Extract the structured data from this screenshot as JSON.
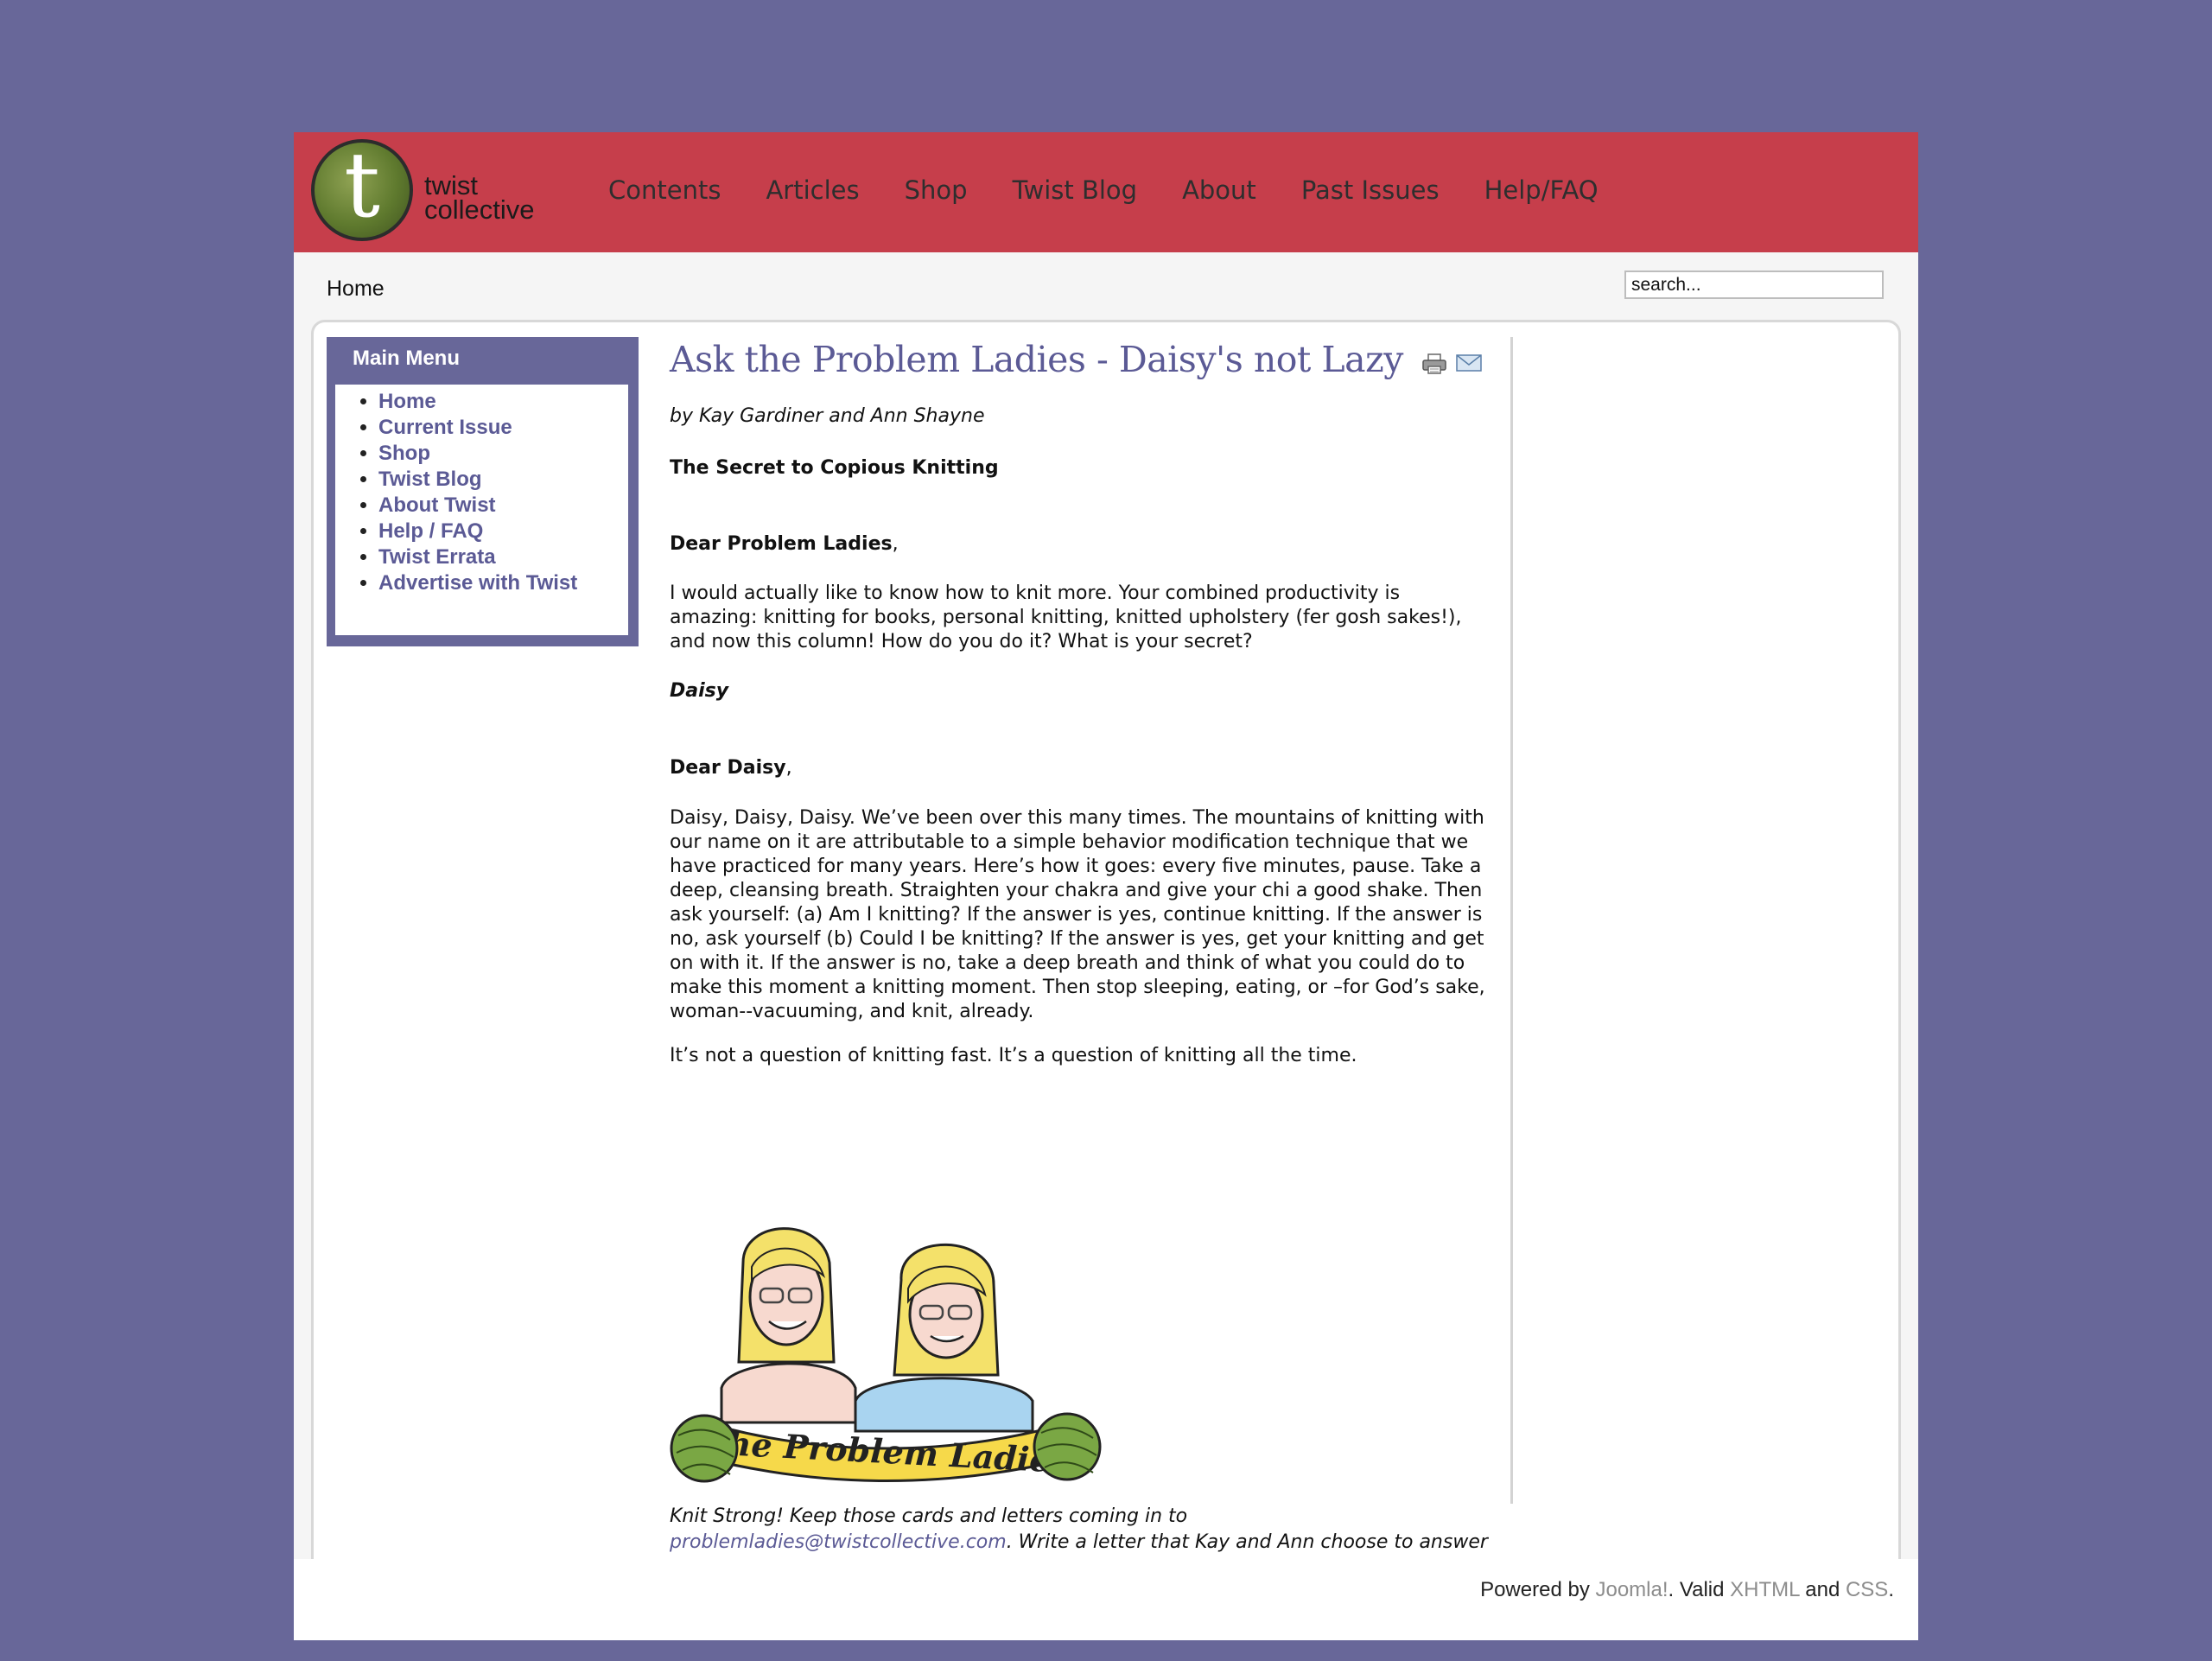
{
  "brand": {
    "logo_letter": "t",
    "logo_line1": "twist",
    "logo_line2": "collective"
  },
  "nav": {
    "items": [
      {
        "label": "Contents"
      },
      {
        "label": "Articles"
      },
      {
        "label": "Shop"
      },
      {
        "label": "Twist Blog"
      },
      {
        "label": "About"
      },
      {
        "label": "Past Issues"
      },
      {
        "label": "Help/FAQ"
      }
    ]
  },
  "breadcrumb": {
    "home": "Home"
  },
  "search": {
    "value": "search..."
  },
  "main_menu": {
    "title": "Main Menu",
    "items": [
      {
        "label": "Home"
      },
      {
        "label": "Current Issue"
      },
      {
        "label": "Shop"
      },
      {
        "label": "Twist Blog"
      },
      {
        "label": "About Twist"
      },
      {
        "label": "Help / FAQ"
      },
      {
        "label": "Twist Errata"
      },
      {
        "label": "Advertise with Twist"
      }
    ]
  },
  "article": {
    "title": "Ask the Problem Ladies - Daisy's not Lazy",
    "byline": "by Kay Gardiner and Ann Shayne",
    "subtitle": "The Secret to Copious Knitting",
    "salutation1_bold": "Dear Problem Ladies",
    "salutation1_punct": ",",
    "letter": "I would actually like to know how to knit more. Your combined productivity is amazing: knitting for books, personal knitting, knitted upholstery (fer gosh sakes!), and now this column! How do you do it? What is your secret?",
    "signature": "Daisy",
    "salutation2_bold": "Dear Daisy",
    "salutation2_punct": ",",
    "answer": "Daisy, Daisy, Daisy. We’ve been over this many times. The mountains of knitting with our name on it are attributable to a simple behavior modification technique that we have practiced for many years. Here’s how it goes: every five minutes, pause. Take a deep, cleansing breath. Straighten your chakra and give your chi a good shake. Then ask yourself: (a) Am I knitting? If the answer is yes, continue knitting. If the answer is no, ask yourself (b) Could I be knitting? If the answer is yes, get your knitting and get on with it. If the answer is no, take a deep breath and think of what you could do to make this moment a knitting moment. Then stop sleeping, eating, or –for God’s sake, woman--vacuuming, and knit, already.",
    "closing": "It’s not a question of knitting fast. It’s a question of knitting all the time.",
    "banner_text": "The Problem Ladies",
    "footer_note_1": "Knit Strong! Keep those cards and letters coming in to",
    "footer_email": "problemladies@twistcollective.com",
    "footer_note_2": ". Write a letter that Kay and Ann choose to answer in the summer issue and we'll send you a Twist Collective button."
  },
  "footer": {
    "powered_by": "Powered by ",
    "joomla": "Joomla!",
    "valid": ". Valid ",
    "xhtml": "XHTML",
    "and": " and ",
    "css": "CSS",
    "end": "."
  },
  "colors": {
    "background": "#686799",
    "header": "#c63e4b",
    "accent": "#5b5a95"
  },
  "icons": [
    "print-icon",
    "email-icon"
  ]
}
